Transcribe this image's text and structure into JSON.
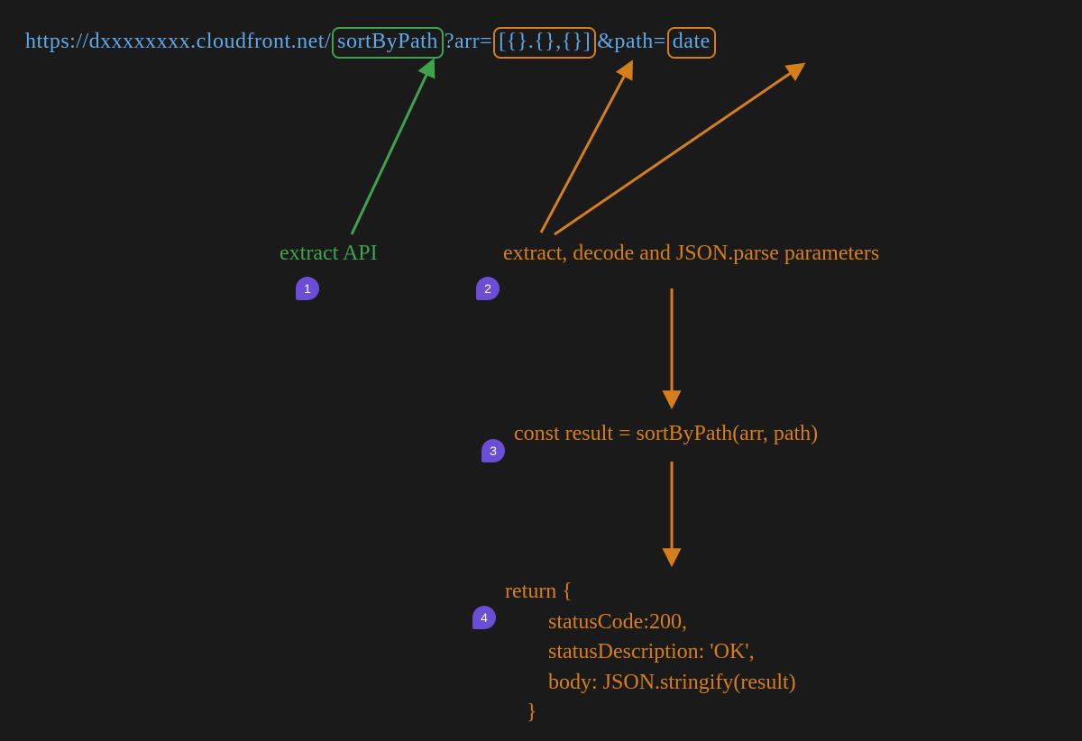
{
  "url": {
    "prefix": "https://dxxxxxxxx.cloudfront.net/",
    "api_segment": "sortByPath",
    "query_prefix": "?arr=",
    "param1": "[{}.{},{}]",
    "query_mid": "&path=",
    "param2": "date"
  },
  "steps": {
    "step1": {
      "num": "1",
      "label": "extract API"
    },
    "step2": {
      "num": "2",
      "label": "extract, decode and JSON.parse parameters"
    },
    "step3": {
      "num": "3",
      "label": "const result = sortByPath(arr, path)"
    },
    "step4": {
      "num": "4",
      "code": "return {\n        statusCode:200,\n        statusDescription: 'OK',\n        body: JSON.stringify(result)\n    }"
    }
  },
  "colors": {
    "bg": "#1a1a1a",
    "blue": "#5fa8e8",
    "green": "#3fa34d",
    "orange": "#d67e1a",
    "purple": "#6b4dd6"
  }
}
